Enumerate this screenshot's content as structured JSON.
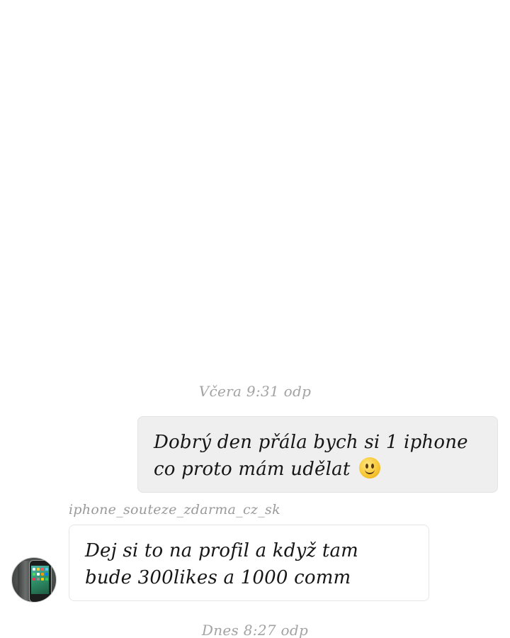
{
  "conversation": {
    "timestamps": {
      "yesterday": "Včera 9:31 odp",
      "today": "Dnes 8:27 odp"
    },
    "outgoing_message": {
      "line1": "Dobrý den přála bych si 1 iphone",
      "line2": "co proto mám udělat",
      "emoji": "slightly-smiling-face"
    },
    "incoming_message": {
      "sender": "iphone_souteze_zdarma_cz_sk",
      "line1": "Dej si to na profil a když tam",
      "line2": "bude 300likes a 1000 comm",
      "avatar": "iphone-avatar"
    }
  },
  "colors": {
    "background": "#ffffff",
    "outgoing_bubble": "#efefef",
    "incoming_bubble": "#ffffff",
    "timestamp_text": "#a3a3a3",
    "message_text": "#161616"
  }
}
